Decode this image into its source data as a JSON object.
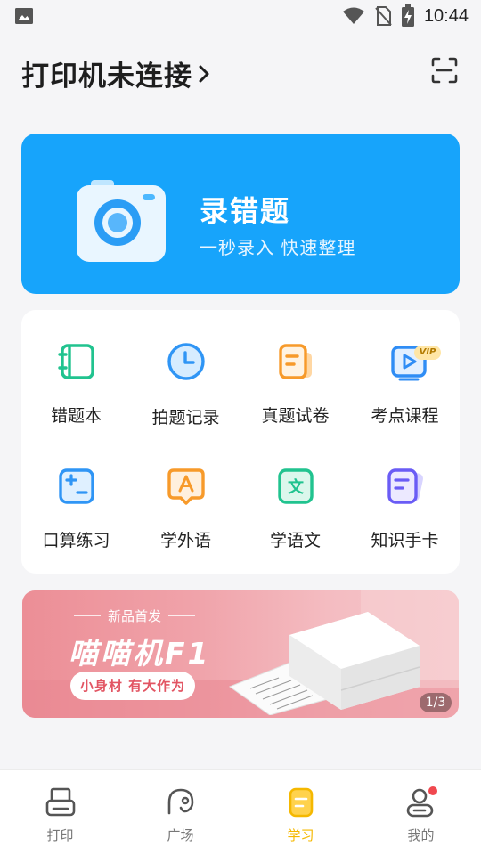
{
  "status_bar": {
    "time": "10:44"
  },
  "header": {
    "title": "打印机未连接"
  },
  "hero": {
    "title": "录错题",
    "subtitle": "一秒录入 快速整理"
  },
  "features": [
    {
      "label": "错题本",
      "icon": "notebook-icon"
    },
    {
      "label": "拍题记录",
      "icon": "clock-icon"
    },
    {
      "label": "真题试卷",
      "icon": "exam-paper-icon"
    },
    {
      "label": "考点课程",
      "icon": "video-course-icon",
      "badge": "VIP"
    },
    {
      "label": "口算练习",
      "icon": "calculator-icon"
    },
    {
      "label": "学外语",
      "icon": "foreign-language-icon"
    },
    {
      "label": "学语文",
      "icon": "chinese-language-icon"
    },
    {
      "label": "知识手卡",
      "icon": "flashcard-icon"
    }
  ],
  "banner": {
    "subtitle": "新品首发",
    "title": "喵喵机F1",
    "tagline": "小身材 有大作为",
    "page_indicator": "1/3"
  },
  "tabbar": {
    "items": [
      {
        "label": "打印",
        "icon": "printer-icon",
        "active": false
      },
      {
        "label": "广场",
        "icon": "square-community-icon",
        "active": false
      },
      {
        "label": "学习",
        "icon": "study-icon",
        "active": true
      },
      {
        "label": "我的",
        "icon": "profile-icon",
        "active": false
      }
    ]
  },
  "colors": {
    "hero_blue": "#17a4fb",
    "active_yellow": "#f5b800",
    "notification_red": "#f0484f",
    "banner_pink": "#ec8e96"
  }
}
